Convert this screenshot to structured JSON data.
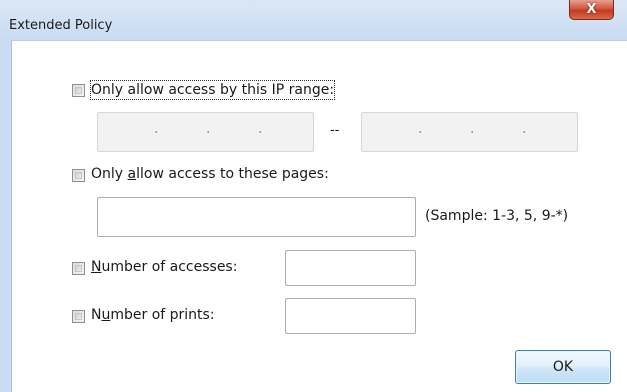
{
  "window": {
    "title": "Extended Policy",
    "close_label": "X"
  },
  "ip_range": {
    "label_main": "Only allow access by this IP range:",
    "checked": false,
    "separator": "--",
    "dot": "·"
  },
  "pages": {
    "label_pre": "Only ",
    "label_accel": "a",
    "label_post": "llow access to these pages:",
    "checked": false,
    "value": "",
    "sample_hint": "(Sample: 1-3, 5, 9-*)"
  },
  "accesses": {
    "label_accel": "N",
    "label_post": "umber of accesses:",
    "checked": false,
    "value": ""
  },
  "prints": {
    "label_pre": "N",
    "label_accel": "u",
    "label_post": "mber of prints:",
    "checked": false,
    "value": ""
  },
  "buttons": {
    "ok_label": "OK"
  }
}
